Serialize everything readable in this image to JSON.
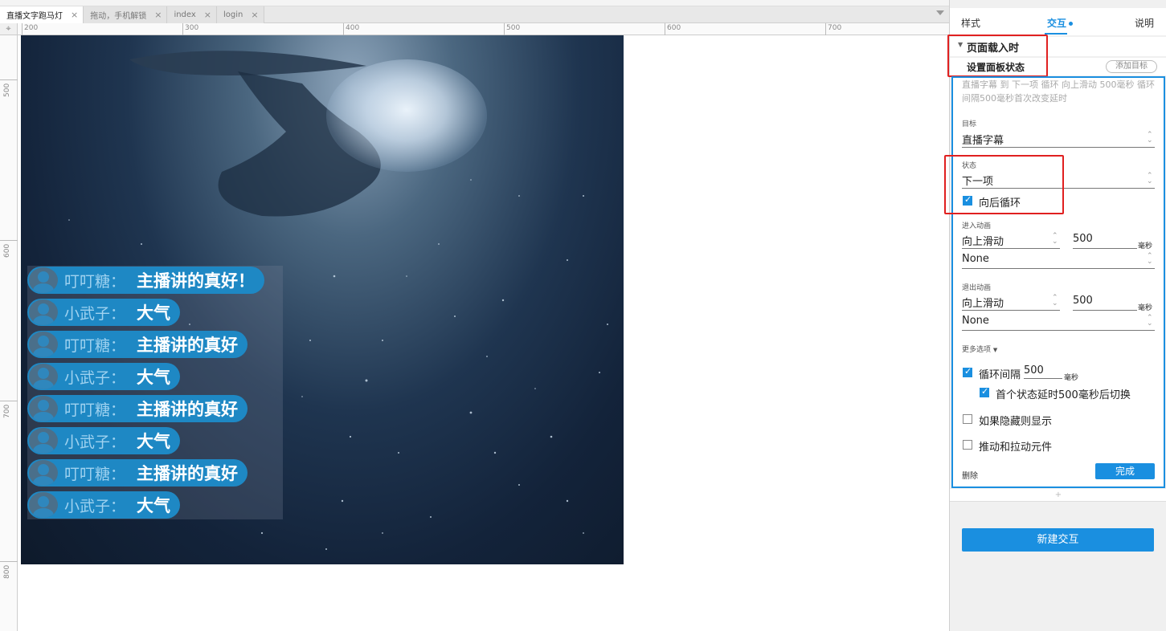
{
  "tabs": [
    {
      "label": "直播文字跑马灯",
      "active": true
    },
    {
      "label": "拖动，手机解锁",
      "active": false
    },
    {
      "label": "index",
      "active": false
    },
    {
      "label": "login",
      "active": false
    }
  ],
  "ruler": {
    "corner_icon": "crosshair-icon",
    "h_labels": [
      "200",
      "300",
      "400",
      "500",
      "600",
      "700"
    ],
    "v_labels": [
      "500",
      "600",
      "700",
      "800"
    ]
  },
  "marquee": {
    "messages": [
      {
        "name": "叮叮糖：",
        "text": "主播讲的真好！"
      },
      {
        "name": "小武子：",
        "text": "大气"
      },
      {
        "name": "叮叮糖：",
        "text": "主播讲的真好"
      },
      {
        "name": "小武子：",
        "text": "大气"
      },
      {
        "name": "叮叮糖：",
        "text": "主播讲的真好"
      },
      {
        "name": "小武子：",
        "text": "大气"
      },
      {
        "name": "叮叮糖：",
        "text": "主播讲的真好"
      },
      {
        "name": "小武子：",
        "text": "大气"
      }
    ]
  },
  "panel": {
    "tabs": {
      "style": "样式",
      "interaction": "交互",
      "notes": "说明"
    },
    "event": "页面载入时",
    "action": "设置面板状态",
    "add_target": "添加目标",
    "summary": "直播字幕 到 下一项 循环 向上滑动 500毫秒 循环间隔500毫秒首次改变延时",
    "target_label": "目标",
    "target_value": "直播字幕",
    "state_label": "状态",
    "state_value": "下一项",
    "wrap_label": "向后循环",
    "enter_label": "进入动画",
    "enter_anim": "向上滑动",
    "enter_ms": "500",
    "enter_unit": "毫秒",
    "enter_ease": "None",
    "exit_label": "退出动画",
    "exit_anim": "向上滑动",
    "exit_ms": "500",
    "exit_unit": "毫秒",
    "exit_ease": "None",
    "more": "更多选项",
    "loop_label": "循环间隔",
    "loop_value": "500",
    "loop_unit": "毫秒",
    "first_delay": "首个状态延时500毫秒后切换",
    "show_if_hidden": "如果隐藏则显示",
    "push_pull": "推动和拉动元件",
    "delete": "删除",
    "done": "完成",
    "new_interaction": "新建交互"
  },
  "colors": {
    "accent": "#1a8fe0",
    "highlight": "#e02020",
    "bubble": "#1e88c4"
  }
}
